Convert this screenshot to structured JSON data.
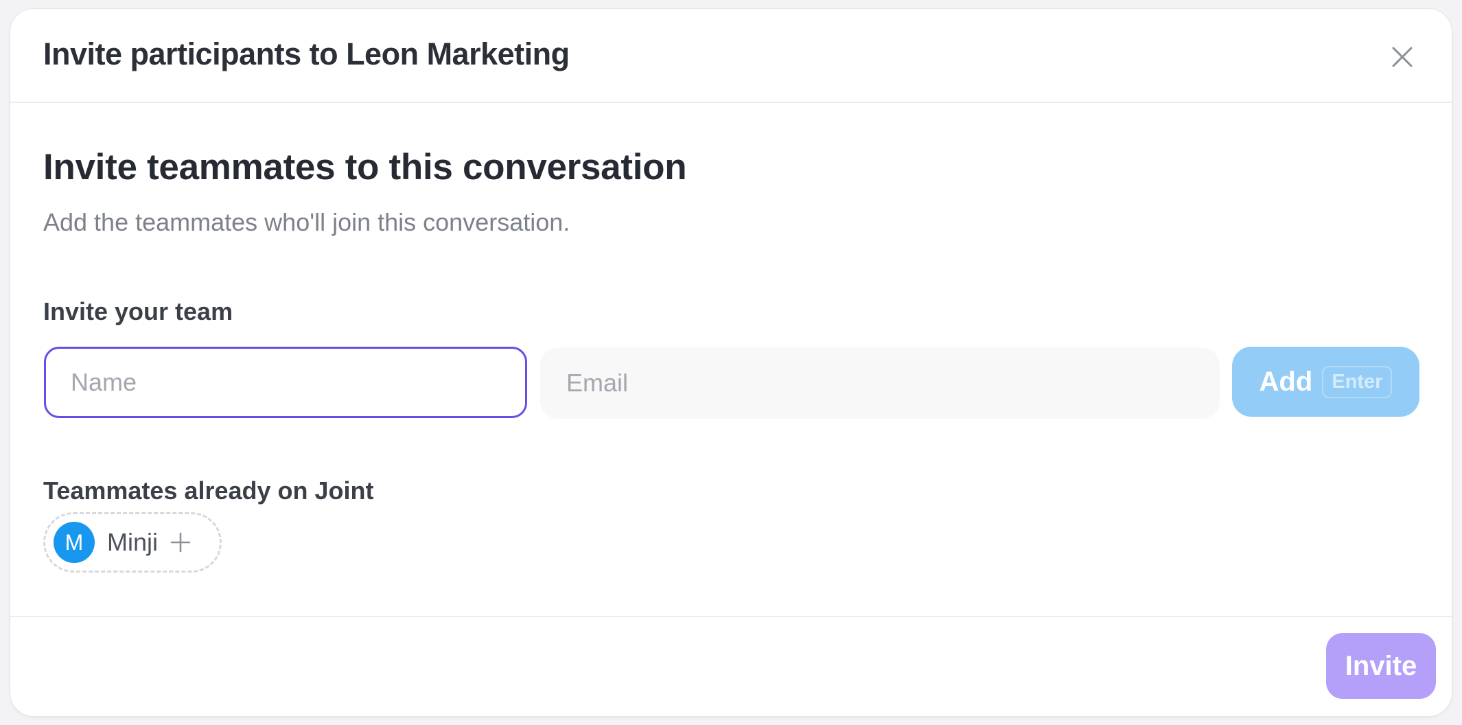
{
  "modal": {
    "title": "Invite participants to Leon Marketing",
    "close_icon": "close-icon"
  },
  "body": {
    "heading": "Invite teammates to this conversation",
    "subtitle": "Add the teammates who'll join this conversation."
  },
  "invite_form": {
    "label": "Invite your team",
    "name_field": {
      "value": "",
      "placeholder": "Name"
    },
    "email_field": {
      "value": "",
      "placeholder": "Email"
    },
    "add_button": {
      "label": "Add",
      "shortcut": "Enter"
    }
  },
  "existing_teammates": {
    "label": "Teammates already on Joint",
    "people": [
      {
        "initial": "M",
        "name": "Minji",
        "avatar_color": "#1797ee",
        "action_icon": "plus-icon"
      }
    ]
  },
  "footer": {
    "invite_button": {
      "label": "Invite"
    }
  },
  "colors": {
    "focus_border": "#6a4de6",
    "add_button_bg": "#93cdf7",
    "invite_button_bg": "#b5a0f9"
  }
}
